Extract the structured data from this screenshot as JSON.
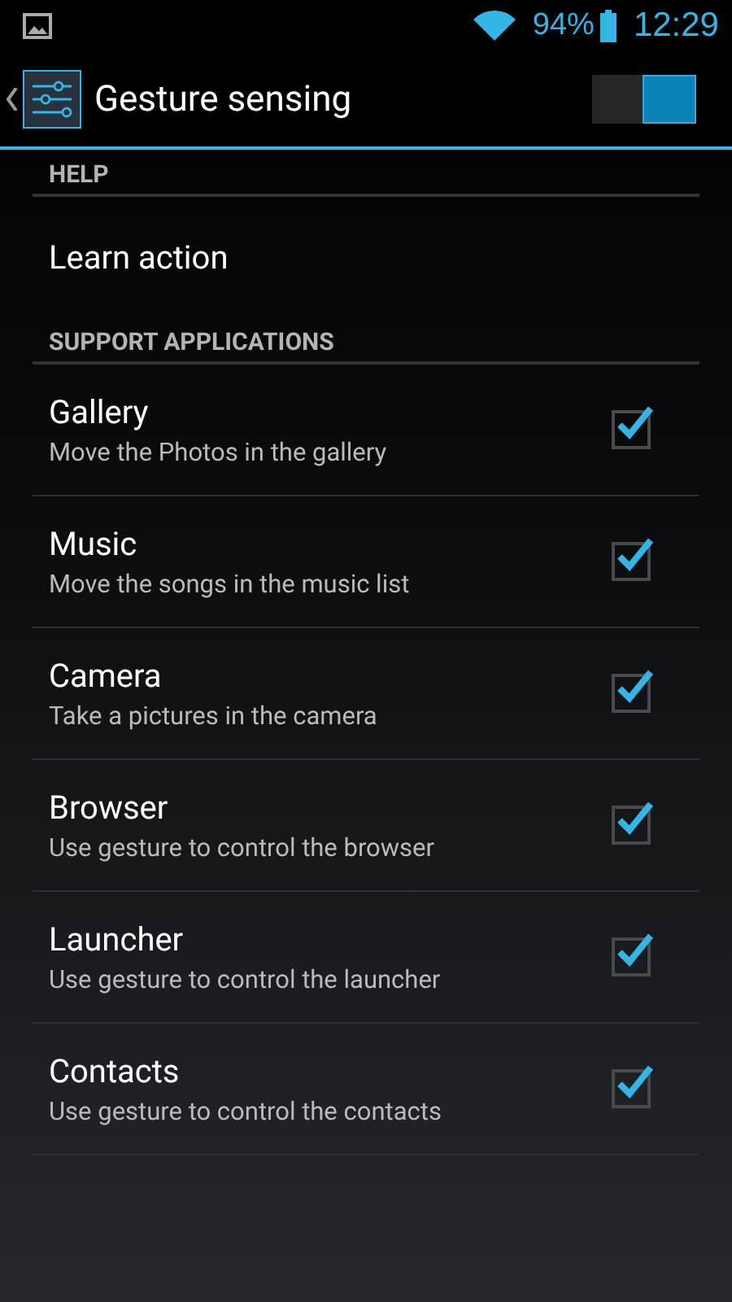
{
  "status_bar": {
    "battery": "94%",
    "time": "12:29"
  },
  "action_bar": {
    "title": "Gesture sensing",
    "switch_on": true
  },
  "sections": [
    {
      "header": "HELP",
      "items": [
        {
          "kind": "plain",
          "title": "Learn action"
        }
      ]
    },
    {
      "header": "SUPPORT APPLICATIONS",
      "items": [
        {
          "kind": "checkbox",
          "title": "Gallery",
          "summary": "Move the Photos in the gallery",
          "checked": true
        },
        {
          "kind": "checkbox",
          "title": "Music",
          "summary": "Move the songs in the music list",
          "checked": true
        },
        {
          "kind": "checkbox",
          "title": "Camera",
          "summary": "Take a pictures in the camera",
          "checked": true
        },
        {
          "kind": "checkbox",
          "title": "Browser",
          "summary": "Use gesture to control the browser",
          "checked": true
        },
        {
          "kind": "checkbox",
          "title": "Launcher",
          "summary": "Use gesture to control the launcher",
          "checked": true
        },
        {
          "kind": "checkbox",
          "title": "Contacts",
          "summary": "Use gesture to control the contacts",
          "checked": true
        }
      ]
    }
  ]
}
